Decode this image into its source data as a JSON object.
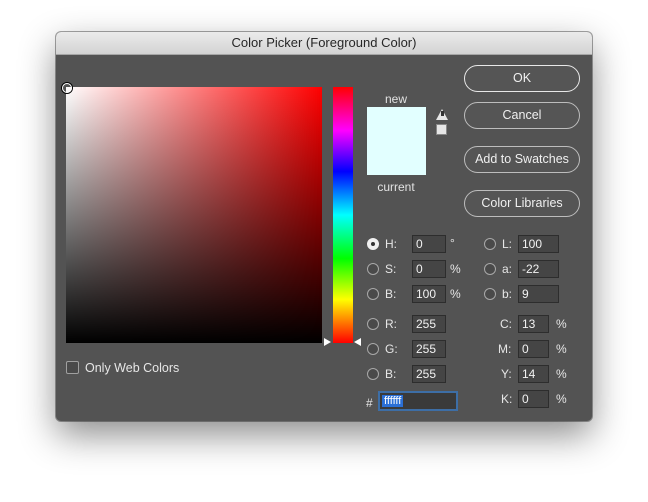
{
  "window": {
    "title": "Color Picker (Foreground Color)"
  },
  "preview": {
    "new_label": "new",
    "current_label": "current",
    "new_color": "#e2ffff",
    "current_color": "#e2ffff"
  },
  "buttons": {
    "ok": "OK",
    "cancel": "Cancel",
    "add_swatches": "Add to Swatches",
    "color_libraries": "Color Libraries"
  },
  "hsb": {
    "h": {
      "label": "H:",
      "value": "0",
      "unit": "°",
      "selected": true
    },
    "s": {
      "label": "S:",
      "value": "0",
      "unit": "%"
    },
    "b": {
      "label": "B:",
      "value": "100",
      "unit": "%"
    }
  },
  "rgb": {
    "r": {
      "label": "R:",
      "value": "255"
    },
    "g": {
      "label": "G:",
      "value": "255"
    },
    "b": {
      "label": "B:",
      "value": "255"
    }
  },
  "lab": {
    "l": {
      "label": "L:",
      "value": "100"
    },
    "a": {
      "label": "a:",
      "value": "-22"
    },
    "b": {
      "label": "b:",
      "value": "9"
    }
  },
  "cmyk": {
    "c": {
      "label": "C:",
      "value": "13",
      "unit": "%"
    },
    "m": {
      "label": "M:",
      "value": "0",
      "unit": "%"
    },
    "y": {
      "label": "Y:",
      "value": "14",
      "unit": "%"
    },
    "k": {
      "label": "K:",
      "value": "0",
      "unit": "%"
    }
  },
  "hex": {
    "prefix": "#",
    "value": "ffffff"
  },
  "options": {
    "only_web_colors": "Only Web Colors"
  },
  "colors": {
    "panel": "#535353",
    "hex_selection": "#2a6fd6",
    "hue_base": "#ff0000"
  }
}
